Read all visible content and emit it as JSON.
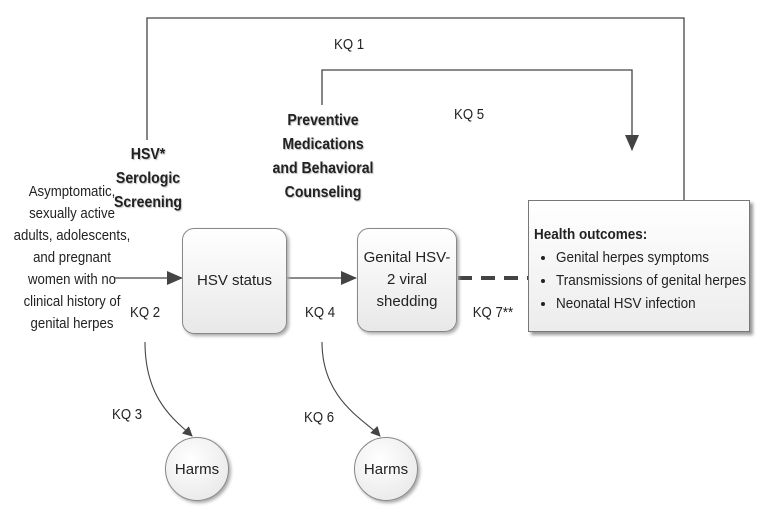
{
  "population": "Asymptomatic, sexually active adults, adolescents, and pregnant women with no clinical history of genital herpes",
  "interventions": {
    "screening": "HSV* Serologic Screening",
    "preventive": "Preventive Medications and Behavioral Counseling"
  },
  "nodes": {
    "hsv_status": "HSV status",
    "viral_shedding": "Genital HSV-2 viral shedding",
    "harms_1": "Harms",
    "harms_2": "Harms"
  },
  "outcomes": {
    "title": "Health outcomes:",
    "items": [
      "Genital herpes symptoms",
      "Transmissions of genital herpes",
      "Neonatal HSV infection"
    ]
  },
  "key_questions": {
    "kq1": "KQ 1",
    "kq2": "KQ 2",
    "kq3": "KQ 3",
    "kq4": "KQ 4",
    "kq5": "KQ 5",
    "kq6": "KQ 6",
    "kq7": "KQ 7**"
  }
}
